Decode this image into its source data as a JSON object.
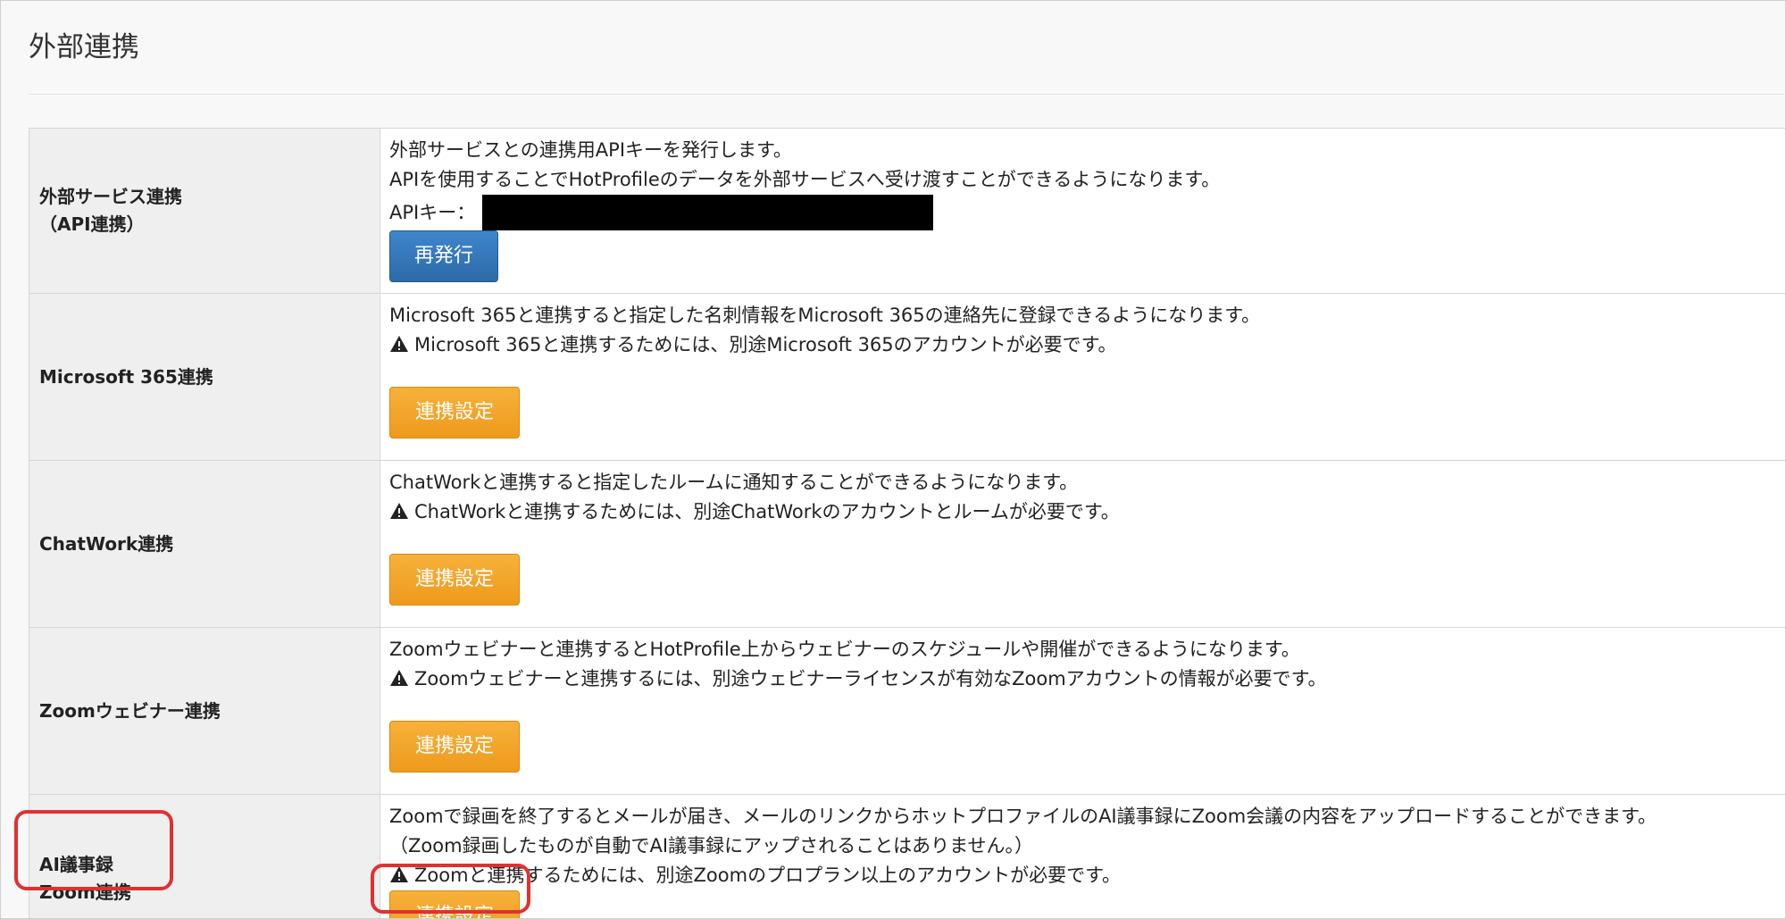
{
  "page": {
    "title": "外部連携"
  },
  "rows": {
    "api": {
      "label_line1": "外部サービス連携",
      "label_line2": "（API連携）",
      "desc1": "外部サービスとの連携用APIキーを発行します。",
      "desc2": "APIを使用することでHotProfileのデータを外部サービスへ受け渡すことができるようになります。",
      "api_key_label": "APIキー：",
      "button": "再発行"
    },
    "microsoft": {
      "label": "Microsoft 365連携",
      "desc1": "Microsoft 365と連携すると指定した名刺情報をMicrosoft 365の連絡先に登録できるようになります。",
      "warning": "Microsoft 365と連携するためには、別途Microsoft 365のアカウントが必要です。",
      "button": "連携設定"
    },
    "chatwork": {
      "label": "ChatWork連携",
      "desc1": "ChatWorkと連携すると指定したルームに通知することができるようになります。",
      "warning": "ChatWorkと連携するためには、別途ChatWorkのアカウントとルームが必要です。",
      "button": "連携設定"
    },
    "zoom_webinar": {
      "label": "Zoomウェビナー連携",
      "desc1": "Zoomウェビナーと連携するとHotProfile上からウェビナーのスケジュールや開催ができるようになります。",
      "warning": "Zoomウェビナーと連携するには、別途ウェビナーライセンスが有効なZoomアカウントの情報が必要です。",
      "button": "連携設定"
    },
    "ai_zoom": {
      "label_line1": "AI議事録",
      "label_line2": "Zoom連携",
      "desc1": "Zoomで録画を終了するとメールが届き、メールのリンクからホットプロファイルのAI議事録にZoom会議の内容をアップロードすることができます。",
      "desc2": "（Zoom録画したものが自動でAI議事録にアップされることはありません。）",
      "warning": "Zoomと連携するためには、別途Zoomのプロプラン以上のアカウントが必要です。",
      "button": "連携設定"
    }
  },
  "icons": {
    "warning": "warning-triangle-icon"
  },
  "colors": {
    "primary_button": "#2d6aa8",
    "orange_button": "#f0a020",
    "highlight": "#e03131",
    "label_bg": "#efefef"
  }
}
